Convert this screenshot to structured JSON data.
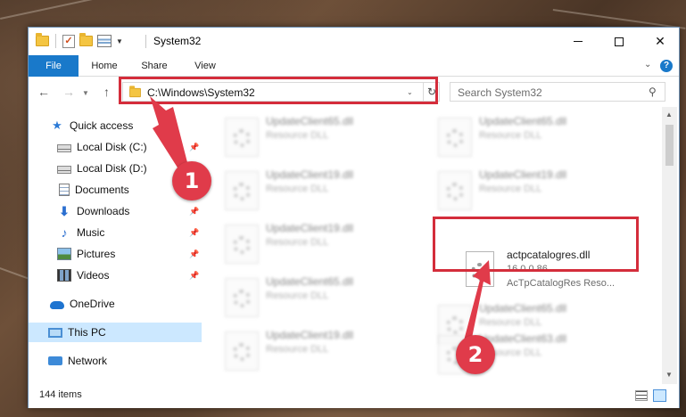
{
  "window": {
    "title": "System32",
    "controls": {
      "minimize": "minimize",
      "maximize": "maximize",
      "close": "✕"
    }
  },
  "ribbon": {
    "tabs": [
      {
        "label": "File"
      },
      {
        "label": "Home"
      },
      {
        "label": "Share"
      },
      {
        "label": "View"
      }
    ],
    "help": "?"
  },
  "navigation": {
    "address": "C:\\Windows\\System32",
    "search_placeholder": "Search System32"
  },
  "sidebar": {
    "items": [
      {
        "label": "Quick access",
        "icon": "star-icon",
        "pinned": false
      },
      {
        "label": "Local Disk (C:)",
        "icon": "drive-icon",
        "pinned": true
      },
      {
        "label": "Local Disk (D:)",
        "icon": "drive-icon",
        "pinned": false
      },
      {
        "label": "Documents",
        "icon": "documents-icon",
        "pinned": true
      },
      {
        "label": "Downloads",
        "icon": "download-icon",
        "pinned": true
      },
      {
        "label": "Music",
        "icon": "music-icon",
        "pinned": true
      },
      {
        "label": "Pictures",
        "icon": "pictures-icon",
        "pinned": true
      },
      {
        "label": "Videos",
        "icon": "videos-icon",
        "pinned": true
      },
      {
        "label": "OneDrive",
        "icon": "cloud-icon",
        "pinned": false
      },
      {
        "label": "This PC",
        "icon": "pc-icon",
        "pinned": false,
        "selected": true
      },
      {
        "label": "Network",
        "icon": "network-icon",
        "pinned": false
      }
    ]
  },
  "files": {
    "left_column": [
      {
        "name": "UpdateClient65.dll",
        "type": "Resource DLL"
      },
      {
        "name": "UpdateClient19.dll",
        "type": "Resource DLL"
      },
      {
        "name": "UpdateClient19.dll",
        "type": "Resource DLL"
      },
      {
        "name": "UpdateClient65.dll",
        "type": "Resource DLL"
      },
      {
        "name": "UpdateClient19.dll",
        "type": "Resource DLL"
      }
    ],
    "right_column": [
      {
        "name": "UpdateClient65.dll",
        "type": "Resource DLL"
      },
      {
        "name": "UpdateClient19.dll",
        "type": "Resource DLL"
      },
      {
        "name": "actpcatalogres.dll",
        "version": "16.0.0.86",
        "description": "AcTpCatalogRes Reso..."
      },
      {
        "name": "UpdateClient65.dll",
        "type": "Resource DLL"
      },
      {
        "name": "UpdateClient63.dll",
        "type": "Resource DLL"
      }
    ]
  },
  "status": {
    "item_count": "144 items"
  },
  "annotations": {
    "marker1": "1",
    "marker2": "2",
    "color": "#e03b4a"
  }
}
